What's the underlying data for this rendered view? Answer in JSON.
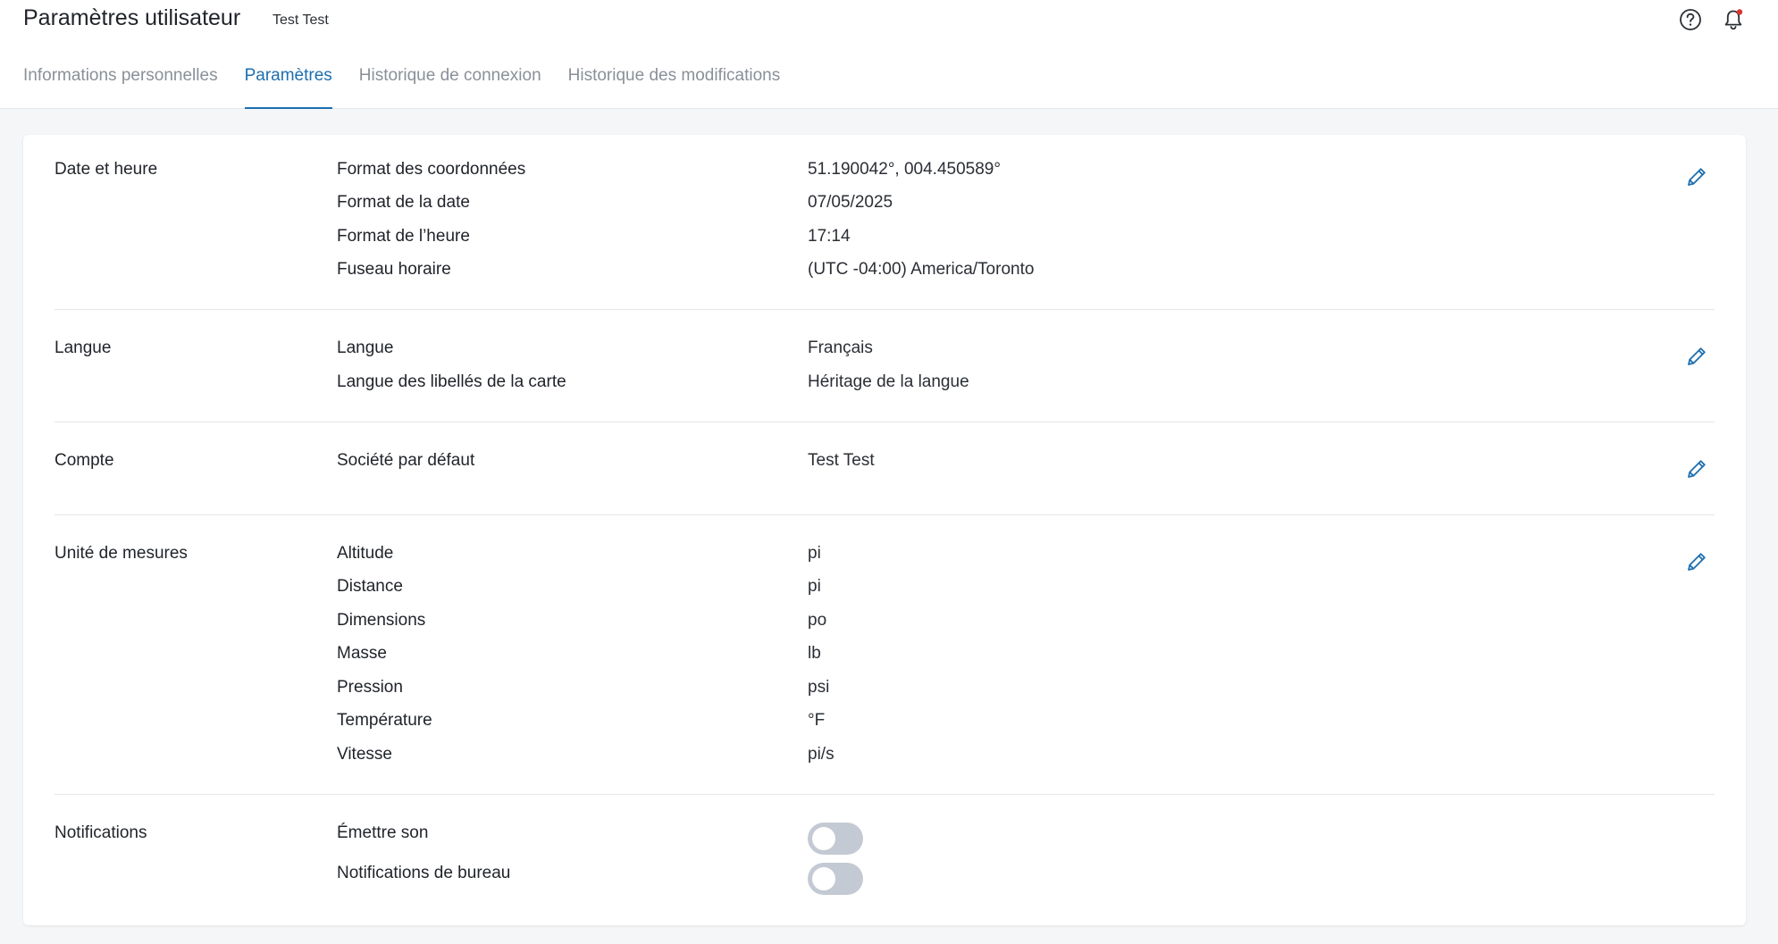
{
  "header": {
    "title": "Paramètres utilisateur",
    "subtitle": "Test Test",
    "icons": {
      "help": "help-circle-icon",
      "notifications": "bell-icon"
    },
    "notification_dot_color": "#d93636"
  },
  "tabs": [
    {
      "label": "Informations personnelles",
      "active": false
    },
    {
      "label": "Paramètres",
      "active": true
    },
    {
      "label": "Historique de connexion",
      "active": false
    },
    {
      "label": "Historique des modifications",
      "active": false
    }
  ],
  "colors": {
    "accent": "#1d6fb0",
    "toggle_off": "#c4cad3"
  },
  "sections": {
    "datetime": {
      "title": "Date et heure",
      "rows": [
        {
          "label": "Format des coordonnées",
          "value": "51.190042°, 004.450589°"
        },
        {
          "label": "Format de la date",
          "value": "07/05/2025"
        },
        {
          "label": "Format de l’heure",
          "value": "17:14"
        },
        {
          "label": "Fuseau horaire",
          "value": "(UTC -04:00) America/Toronto"
        }
      ]
    },
    "language": {
      "title": "Langue",
      "rows": [
        {
          "label": "Langue",
          "value": "Français"
        },
        {
          "label": "Langue des libellés de la carte",
          "value": "Héritage de la langue"
        }
      ]
    },
    "account": {
      "title": "Compte",
      "rows": [
        {
          "label": "Société par défaut",
          "value": "Test Test"
        }
      ]
    },
    "units": {
      "title": "Unité de mesures",
      "rows": [
        {
          "label": "Altitude",
          "value": "pi"
        },
        {
          "label": "Distance",
          "value": "pi"
        },
        {
          "label": "Dimensions",
          "value": "po"
        },
        {
          "label": "Masse",
          "value": "lb"
        },
        {
          "label": "Pression",
          "value": "psi"
        },
        {
          "label": "Température",
          "value": "°F"
        },
        {
          "label": "Vitesse",
          "value": "pi/s"
        }
      ]
    },
    "notifications": {
      "title": "Notifications",
      "rows": [
        {
          "label": "Émettre son",
          "enabled": false
        },
        {
          "label": "Notifications de bureau",
          "enabled": false
        }
      ]
    }
  }
}
